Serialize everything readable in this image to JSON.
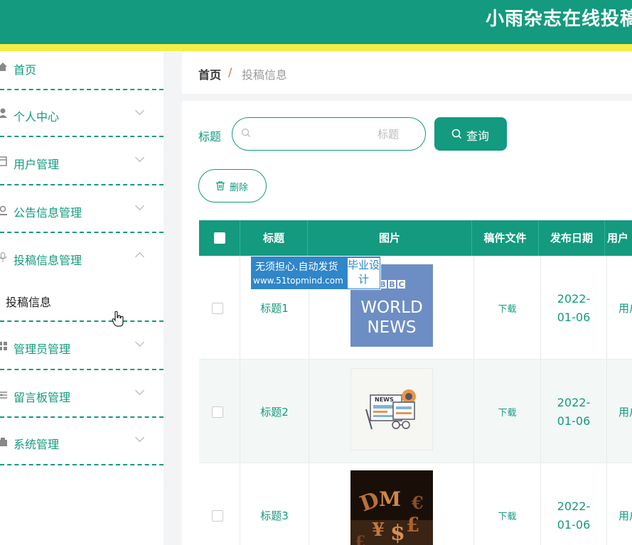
{
  "header": {
    "title": "小雨杂志在线投稿",
    "bg": "#139a7f",
    "stripe": "#f3ee46"
  },
  "sidebar": {
    "items": [
      {
        "label": "首页",
        "icon": "home-icon",
        "chevron": "none"
      },
      {
        "label": "个人中心",
        "icon": "user-icon",
        "chevron": "down"
      },
      {
        "label": "用户管理",
        "icon": "users-icon",
        "chevron": "down"
      },
      {
        "label": "公告信息管理",
        "icon": "notice-icon",
        "chevron": "down"
      },
      {
        "label": "投稿信息管理",
        "icon": "mic-icon",
        "chevron": "up"
      },
      {
        "label": "管理员管理",
        "icon": "grid-icon",
        "chevron": "down"
      },
      {
        "label": "留言板管理",
        "icon": "message-icon",
        "chevron": "down"
      },
      {
        "label": "系统管理",
        "icon": "settings-icon",
        "chevron": "down"
      }
    ],
    "sub_item": "投稿信息"
  },
  "breadcrumb": {
    "home": "首页",
    "separator": "/",
    "current": "投稿信息"
  },
  "search": {
    "label": "标题",
    "placeholder": "标题",
    "value": "",
    "button": "查询"
  },
  "toolbar": {
    "delete": "删除"
  },
  "table": {
    "headers": [
      "标题",
      "图片",
      "稿件文件",
      "发布日期",
      "用户"
    ],
    "rows": [
      {
        "title": "标题1",
        "image": "bbc-world-news",
        "file": "下载",
        "date": "2022-01-06",
        "user": "用户"
      },
      {
        "title": "标题2",
        "image": "news-illustration",
        "file": "下载",
        "date": "2022-01-06",
        "user": "用户"
      },
      {
        "title": "标题3",
        "image": "currency-symbols",
        "file": "下载",
        "date": "2022-01-06",
        "user": "用户"
      }
    ]
  },
  "watermark": {
    "line1": "无须担心.自动发货",
    "line2": "www.51topmind.com",
    "box": "毕业设计"
  }
}
